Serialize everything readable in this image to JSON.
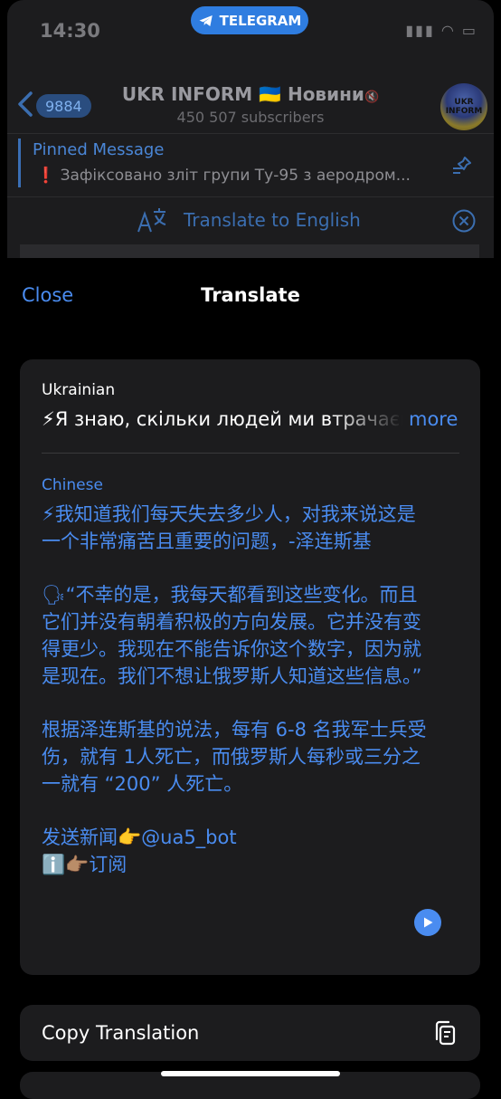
{
  "status_bar": {
    "time": "14:30",
    "icons": "▮▮▮ ◠ ▭"
  },
  "telegram_pill": {
    "label": "TELEGRAM"
  },
  "chat_header": {
    "back_badge": "9884",
    "title": "UKR INFORM 🇺🇦 Новини",
    "muted_icon": "🔇",
    "subtitle": "450 507 subscribers",
    "avatar_text": "UKR INFORM"
  },
  "pinned": {
    "title": "Pinned Message",
    "text": "❗ Зафіксовано зліт групи Ту-95 з аеродром..."
  },
  "translate_bar": {
    "label": "Translate to English"
  },
  "sheet": {
    "close_label": "Close",
    "title": "Translate",
    "source_language": "Ukrainian",
    "source_text": "⚡Я знаю, скільки людей ми втрачаємо щодня",
    "more_label": "more",
    "target_language": "Chinese",
    "target_paragraphs": [
      "⚡我知道我们每天失去多少人，对我来说这是一个非常痛苦且重要的问题，-泽连斯基",
      "🗣“不幸的是，我每天都看到这些变化。而且它们并没有朝着积极的方向发展。它并没有变得更少。我现在不能告诉你这个数字，因为就是现在。我们不想让俄罗斯人知道这些信息。”",
      "根据泽连斯基的说法，每有 6-8 名我军士兵受伤，就有 1人死亡，而俄罗斯人每秒或三分之一就有 “200” 人死亡。",
      "发送新闻👉@ua5_bot\nℹ️👉🏽订阅"
    ],
    "copy_label": "Copy Translation"
  },
  "colors": {
    "accent": "#4a8cf0",
    "card": "#1c1c1e",
    "background": "#000000"
  },
  "icons": [
    "telegram-icon",
    "chevron-left-icon",
    "mute-icon",
    "pin-icon",
    "translate-icon",
    "close-circle-icon",
    "play-icon",
    "copy-icon"
  ]
}
